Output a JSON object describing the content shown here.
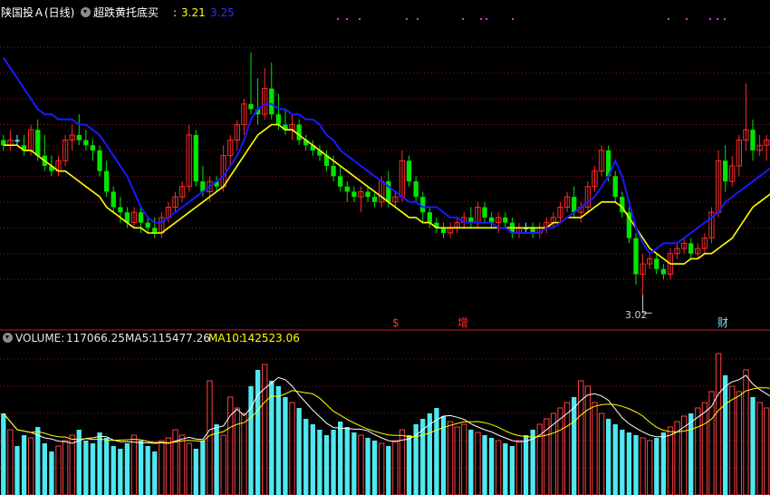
{
  "header": {
    "stock_title": "陕国投Ａ(日线)",
    "indicator_name": "超跌黄托底买",
    "colon": ":",
    "value1": "3.21",
    "value2": "3.25"
  },
  "volume_header": {
    "volume_label": "VOLUME:",
    "volume_value": "117066.25",
    "ma5_label": "MA5:",
    "ma5_value": "115477.26",
    "ma10_label": "MA10:",
    "ma10_value": "142523.06"
  },
  "markers": {
    "low_price": "3.02",
    "marker_dollar": "$",
    "marker_zeng": "增",
    "marker_cai": "财"
  },
  "colors": {
    "background": "#000000",
    "up_candle": "#ff2a2a",
    "down_candle": "#00e600",
    "doji": "#7ff5ff",
    "yellow_line": "#ffff00",
    "blue_line": "#1a1aff",
    "grid": "#a01010",
    "vol_up": "#ff4040",
    "vol_down": "#4fe8f0",
    "ma5_line": "#ffffff",
    "ma10_line": "#ffff00"
  },
  "chart_data": {
    "type": "candlestick",
    "price_yaxis": [
      2.98,
      3.56
    ],
    "candles": [
      [
        3.32,
        3.33,
        3.3,
        3.31
      ],
      [
        3.31,
        3.34,
        3.3,
        3.32
      ],
      [
        3.32,
        3.33,
        3.31,
        3.32
      ],
      [
        3.31,
        3.33,
        3.29,
        3.3
      ],
      [
        3.3,
        3.35,
        3.29,
        3.34
      ],
      [
        3.34,
        3.36,
        3.28,
        3.29
      ],
      [
        3.29,
        3.33,
        3.26,
        3.27
      ],
      [
        3.27,
        3.29,
        3.25,
        3.26
      ],
      [
        3.26,
        3.29,
        3.25,
        3.28
      ],
      [
        3.28,
        3.33,
        3.27,
        3.32
      ],
      [
        3.32,
        3.35,
        3.3,
        3.33
      ],
      [
        3.33,
        3.37,
        3.31,
        3.32
      ],
      [
        3.32,
        3.34,
        3.3,
        3.31
      ],
      [
        3.31,
        3.32,
        3.28,
        3.3
      ],
      [
        3.3,
        3.31,
        3.25,
        3.26
      ],
      [
        3.26,
        3.28,
        3.21,
        3.22
      ],
      [
        3.22,
        3.23,
        3.18,
        3.19
      ],
      [
        3.19,
        3.21,
        3.16,
        3.18
      ],
      [
        3.18,
        3.19,
        3.15,
        3.16
      ],
      [
        3.16,
        3.19,
        3.15,
        3.18
      ],
      [
        3.18,
        3.19,
        3.14,
        3.16
      ],
      [
        3.16,
        3.17,
        3.14,
        3.15
      ],
      [
        3.15,
        3.17,
        3.13,
        3.14
      ],
      [
        3.14,
        3.18,
        3.13,
        3.17
      ],
      [
        3.17,
        3.2,
        3.16,
        3.19
      ],
      [
        3.19,
        3.22,
        3.18,
        3.21
      ],
      [
        3.21,
        3.24,
        3.2,
        3.23
      ],
      [
        3.23,
        3.35,
        3.22,
        3.33
      ],
      [
        3.33,
        3.34,
        3.23,
        3.24
      ],
      [
        3.24,
        3.27,
        3.21,
        3.22
      ],
      [
        3.22,
        3.25,
        3.2,
        3.24
      ],
      [
        3.24,
        3.25,
        3.22,
        3.23
      ],
      [
        3.23,
        3.31,
        3.22,
        3.29
      ],
      [
        3.29,
        3.33,
        3.27,
        3.32
      ],
      [
        3.32,
        3.36,
        3.3,
        3.35
      ],
      [
        3.35,
        3.4,
        3.33,
        3.39
      ],
      [
        3.39,
        3.49,
        3.37,
        3.38
      ],
      [
        3.38,
        3.44,
        3.35,
        3.37
      ],
      [
        3.37,
        3.46,
        3.36,
        3.42
      ],
      [
        3.42,
        3.47,
        3.36,
        3.37
      ],
      [
        3.37,
        3.41,
        3.34,
        3.35
      ],
      [
        3.35,
        3.38,
        3.33,
        3.34
      ],
      [
        3.34,
        3.37,
        3.32,
        3.35
      ],
      [
        3.35,
        3.36,
        3.31,
        3.32
      ],
      [
        3.32,
        3.33,
        3.3,
        3.31
      ],
      [
        3.31,
        3.32,
        3.29,
        3.3
      ],
      [
        3.3,
        3.31,
        3.28,
        3.29
      ],
      [
        3.29,
        3.3,
        3.26,
        3.27
      ],
      [
        3.27,
        3.29,
        3.24,
        3.25
      ],
      [
        3.25,
        3.27,
        3.22,
        3.23
      ],
      [
        3.23,
        3.24,
        3.2,
        3.22
      ],
      [
        3.22,
        3.23,
        3.2,
        3.21
      ],
      [
        3.21,
        3.23,
        3.18,
        3.22
      ],
      [
        3.22,
        3.23,
        3.2,
        3.21
      ],
      [
        3.21,
        3.22,
        3.19,
        3.2
      ],
      [
        3.2,
        3.25,
        3.19,
        3.24
      ],
      [
        3.24,
        3.26,
        3.19,
        3.2
      ],
      [
        3.2,
        3.22,
        3.19,
        3.21
      ],
      [
        3.21,
        3.3,
        3.2,
        3.28
      ],
      [
        3.28,
        3.29,
        3.23,
        3.24
      ],
      [
        3.24,
        3.25,
        3.2,
        3.21
      ],
      [
        3.21,
        3.22,
        3.16,
        3.18
      ],
      [
        3.18,
        3.19,
        3.15,
        3.16
      ],
      [
        3.16,
        3.17,
        3.14,
        3.15
      ],
      [
        3.15,
        3.16,
        3.13,
        3.14
      ],
      [
        3.14,
        3.16,
        3.13,
        3.15
      ],
      [
        3.15,
        3.17,
        3.14,
        3.16
      ],
      [
        3.16,
        3.18,
        3.15,
        3.17
      ],
      [
        3.17,
        3.19,
        3.15,
        3.16
      ],
      [
        3.16,
        3.2,
        3.15,
        3.19
      ],
      [
        3.19,
        3.2,
        3.16,
        3.17
      ],
      [
        3.17,
        3.18,
        3.15,
        3.16
      ],
      [
        3.16,
        3.18,
        3.14,
        3.17
      ],
      [
        3.17,
        3.18,
        3.15,
        3.16
      ],
      [
        3.16,
        3.17,
        3.13,
        3.14
      ],
      [
        3.14,
        3.16,
        3.13,
        3.15
      ],
      [
        3.15,
        3.16,
        3.14,
        3.15
      ],
      [
        3.15,
        3.16,
        3.13,
        3.14
      ],
      [
        3.14,
        3.16,
        3.13,
        3.15
      ],
      [
        3.15,
        3.17,
        3.14,
        3.16
      ],
      [
        3.16,
        3.18,
        3.15,
        3.17
      ],
      [
        3.17,
        3.2,
        3.16,
        3.19
      ],
      [
        3.19,
        3.22,
        3.18,
        3.21
      ],
      [
        3.21,
        3.23,
        3.17,
        3.18
      ],
      [
        3.18,
        3.2,
        3.16,
        3.19
      ],
      [
        3.19,
        3.24,
        3.18,
        3.23
      ],
      [
        3.23,
        3.27,
        3.22,
        3.26
      ],
      [
        3.26,
        3.31,
        3.25,
        3.3
      ],
      [
        3.3,
        3.31,
        3.24,
        3.25
      ],
      [
        3.25,
        3.26,
        3.2,
        3.21
      ],
      [
        3.21,
        3.22,
        3.17,
        3.18
      ],
      [
        3.18,
        3.19,
        3.12,
        3.13
      ],
      [
        3.13,
        3.14,
        3.04,
        3.06
      ],
      [
        3.06,
        3.1,
        3.02,
        3.08
      ],
      [
        3.08,
        3.1,
        3.07,
        3.09
      ],
      [
        3.09,
        3.1,
        3.06,
        3.07
      ],
      [
        3.07,
        3.08,
        3.05,
        3.06
      ],
      [
        3.06,
        3.11,
        3.05,
        3.1
      ],
      [
        3.1,
        3.12,
        3.09,
        3.11
      ],
      [
        3.11,
        3.13,
        3.1,
        3.12
      ],
      [
        3.12,
        3.13,
        3.09,
        3.1
      ],
      [
        3.1,
        3.12,
        3.09,
        3.11
      ],
      [
        3.11,
        3.14,
        3.1,
        3.13
      ],
      [
        3.13,
        3.19,
        3.12,
        3.18
      ],
      [
        3.18,
        3.3,
        3.17,
        3.28
      ],
      [
        3.28,
        3.31,
        3.22,
        3.24
      ],
      [
        3.24,
        3.29,
        3.23,
        3.27
      ],
      [
        3.27,
        3.33,
        3.25,
        3.32
      ],
      [
        3.32,
        3.43,
        3.3,
        3.34
      ],
      [
        3.34,
        3.36,
        3.28,
        3.3
      ],
      [
        3.3,
        3.33,
        3.29,
        3.31
      ],
      [
        3.31,
        3.33,
        3.28,
        3.32
      ]
    ],
    "yellow_line": [
      3.31,
      3.31,
      3.31,
      3.3,
      3.3,
      3.29,
      3.28,
      3.27,
      3.26,
      3.26,
      3.25,
      3.24,
      3.23,
      3.22,
      3.21,
      3.19,
      3.18,
      3.17,
      3.16,
      3.15,
      3.15,
      3.14,
      3.14,
      3.14,
      3.15,
      3.16,
      3.17,
      3.18,
      3.19,
      3.2,
      3.21,
      3.22,
      3.23,
      3.25,
      3.27,
      3.29,
      3.31,
      3.33,
      3.34,
      3.35,
      3.35,
      3.34,
      3.34,
      3.33,
      3.32,
      3.31,
      3.3,
      3.29,
      3.28,
      3.27,
      3.26,
      3.25,
      3.24,
      3.23,
      3.22,
      3.21,
      3.2,
      3.19,
      3.18,
      3.17,
      3.17,
      3.16,
      3.16,
      3.15,
      3.15,
      3.15,
      3.15,
      3.15,
      3.15,
      3.15,
      3.15,
      3.15,
      3.15,
      3.15,
      3.15,
      3.15,
      3.15,
      3.15,
      3.15,
      3.15,
      3.16,
      3.16,
      3.17,
      3.17,
      3.17,
      3.18,
      3.19,
      3.2,
      3.2,
      3.2,
      3.19,
      3.17,
      3.15,
      3.13,
      3.11,
      3.1,
      3.09,
      3.08,
      3.08,
      3.08,
      3.09,
      3.09,
      3.1,
      3.1,
      3.11,
      3.12,
      3.13,
      3.15,
      3.17,
      3.19,
      3.2,
      3.21,
      3.22
    ],
    "blue_line": [
      3.48,
      3.46,
      3.44,
      3.42,
      3.4,
      3.38,
      3.37,
      3.37,
      3.36,
      3.36,
      3.36,
      3.35,
      3.35,
      3.34,
      3.33,
      3.31,
      3.29,
      3.27,
      3.25,
      3.22,
      3.19,
      3.17,
      3.16,
      3.16,
      3.17,
      3.18,
      3.19,
      3.2,
      3.21,
      3.22,
      3.23,
      3.24,
      3.25,
      3.27,
      3.29,
      3.32,
      3.36,
      3.38,
      3.39,
      3.39,
      3.38,
      3.38,
      3.37,
      3.37,
      3.36,
      3.36,
      3.35,
      3.33,
      3.32,
      3.3,
      3.29,
      3.28,
      3.27,
      3.26,
      3.25,
      3.24,
      3.23,
      3.22,
      3.21,
      3.2,
      3.2,
      3.19,
      3.19,
      3.19,
      3.18,
      3.17,
      3.17,
      3.16,
      3.16,
      3.16,
      3.16,
      3.16,
      3.15,
      3.15,
      3.14,
      3.14,
      3.14,
      3.14,
      3.14,
      3.15,
      3.15,
      3.16,
      3.17,
      3.18,
      3.19,
      3.2,
      3.21,
      3.23,
      3.25,
      3.28,
      3.25,
      3.2,
      3.15,
      3.12,
      3.1,
      3.11,
      3.12,
      3.12,
      3.12,
      3.13,
      3.14,
      3.15,
      3.16,
      3.17,
      3.18,
      3.2,
      3.21,
      3.22,
      3.23,
      3.24,
      3.25,
      3.26,
      3.27
    ],
    "volume_yaxis": [
      0,
      280000
    ],
    "volume": [
      150000,
      120000,
      90000,
      110000,
      105000,
      125000,
      95000,
      80000,
      90000,
      100000,
      110000,
      120000,
      100000,
      95000,
      115000,
      105000,
      90000,
      85000,
      95000,
      110000,
      100000,
      90000,
      80000,
      100000,
      105000,
      120000,
      110000,
      95000,
      85000,
      100000,
      210000,
      130000,
      110000,
      180000,
      160000,
      150000,
      200000,
      230000,
      240000,
      210000,
      200000,
      180000,
      170000,
      160000,
      140000,
      130000,
      120000,
      110000,
      120000,
      135000,
      125000,
      115000,
      110000,
      105000,
      100000,
      95000,
      90000,
      100000,
      120000,
      110000,
      130000,
      140000,
      150000,
      160000,
      145000,
      135000,
      125000,
      130000,
      120000,
      115000,
      110000,
      105000,
      100000,
      95000,
      90000,
      100000,
      110000,
      120000,
      130000,
      140000,
      150000,
      160000,
      170000,
      180000,
      210000,
      200000,
      170000,
      150000,
      140000,
      130000,
      120000,
      115000,
      110000,
      105000,
      100000,
      105000,
      115000,
      125000,
      135000,
      145000,
      150000,
      160000,
      170000,
      190000,
      260000,
      220000,
      200000,
      190000,
      230000,
      180000,
      170000,
      160000,
      150000,
      117066
    ],
    "volume_ma5": [
      115477.26
    ],
    "volume_ma10": [
      142523.06
    ],
    "annotations": [
      {
        "type": "low",
        "value": 3.02
      },
      {
        "type": "event",
        "text": "$"
      },
      {
        "type": "event",
        "text": "增"
      },
      {
        "type": "event",
        "text": "财"
      }
    ]
  }
}
